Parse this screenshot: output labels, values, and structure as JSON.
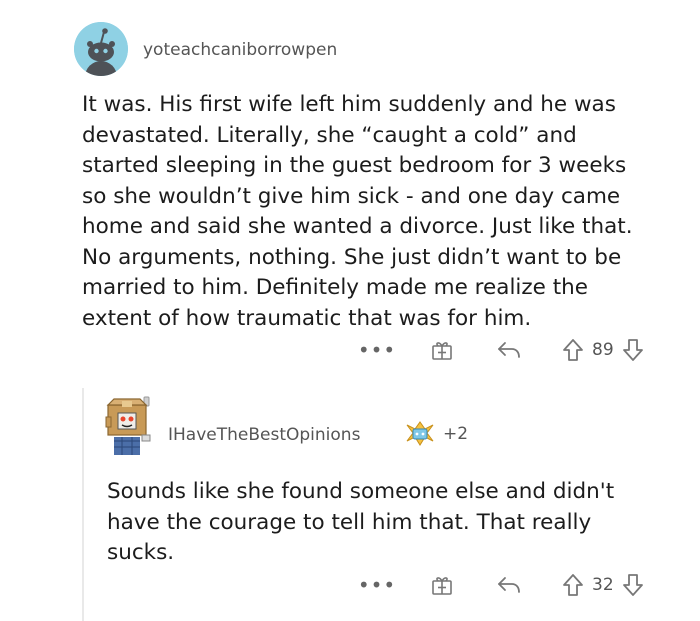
{
  "comments": [
    {
      "username": "yoteachcaniborrowpen",
      "avatar": "snoo-avatar",
      "lines": [
        "It was. His first wife left him suddenly and he was",
        "devastated. Literally, she “caught a cold” and",
        "started sleeping in the guest bedroom for 3 weeks",
        "so she wouldn’t give him sick - and one day came",
        "home and said she wanted a divorce. Just like that.",
        "No arguments, nothing. She just didn’t want to be",
        "married to him. Definitely made me realize the",
        "extent of how traumatic that was for him."
      ],
      "actions": {
        "more": "•••",
        "votes": "89"
      }
    },
    {
      "username": "IHaveTheBestOpinions",
      "avatar": "box-head-avatar",
      "awards": "+2",
      "lines": [
        "Sounds like she found someone else and didn't",
        "have the courage to tell him that. That really",
        "sucks."
      ],
      "actions": {
        "more": "•••",
        "votes": "32"
      }
    }
  ],
  "icons": {
    "more": "more-options-icon",
    "gift": "gift-award-icon",
    "reply": "reply-icon",
    "upvote": "upvote-icon",
    "downvote": "downvote-icon",
    "award": "award-badge-icon"
  }
}
